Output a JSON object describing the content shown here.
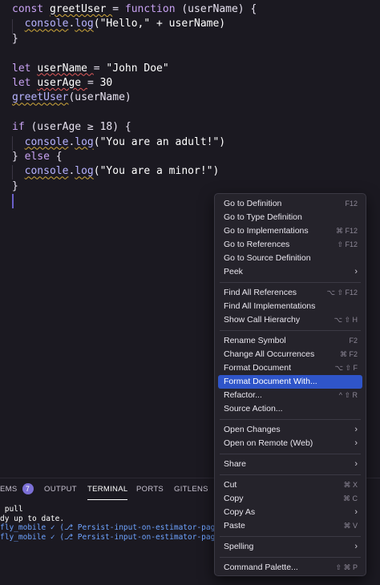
{
  "editor": {
    "lines": [
      {
        "parts": [
          [
            "kw",
            "const "
          ],
          [
            "var",
            "greetUser "
          ],
          [
            "op",
            "= "
          ],
          [
            "kw",
            "function "
          ],
          [
            "op",
            "(userName) {"
          ]
        ]
      },
      {
        "parts": [
          [
            "op",
            "  "
          ],
          [
            "fn",
            "console"
          ],
          [
            "op",
            "."
          ],
          [
            "fn",
            "log"
          ],
          [
            "str",
            "(\"Hello,\" + userName)"
          ]
        ]
      },
      {
        "parts": [
          [
            "op",
            "}"
          ]
        ]
      },
      {
        "parts": []
      },
      {
        "parts": [
          [
            "kw",
            "let "
          ],
          [
            "var",
            "userName "
          ],
          [
            "op",
            "= "
          ],
          [
            "str",
            "\"John Doe\""
          ]
        ]
      },
      {
        "parts": [
          [
            "kw",
            "let "
          ],
          [
            "var",
            "userAge "
          ],
          [
            "op",
            "= "
          ],
          [
            "num",
            "30"
          ]
        ]
      },
      {
        "parts": [
          [
            "fn",
            "greetUser"
          ],
          [
            "op",
            "(userName)"
          ]
        ]
      },
      {
        "parts": []
      },
      {
        "parts": [
          [
            "kw",
            "if "
          ],
          [
            "op",
            "(userAge ≥ 18) {"
          ]
        ]
      },
      {
        "parts": [
          [
            "op",
            "  "
          ],
          [
            "fn",
            "console"
          ],
          [
            "op",
            "."
          ],
          [
            "fn",
            "log"
          ],
          [
            "str",
            "(\"You are an adult!\")"
          ]
        ]
      },
      {
        "parts": [
          [
            "op",
            "} "
          ],
          [
            "kw",
            "else "
          ],
          [
            "op",
            "{"
          ]
        ]
      },
      {
        "parts": [
          [
            "op",
            "  "
          ],
          [
            "fn",
            "console"
          ],
          [
            "op",
            "."
          ],
          [
            "fn",
            "log"
          ],
          [
            "str",
            "(\"You are a minor!\")"
          ]
        ]
      },
      {
        "parts": [
          [
            "op",
            "}"
          ]
        ]
      }
    ]
  },
  "panel": {
    "tabs": {
      "problems": "EMS",
      "problems_count": "7",
      "output": "OUTPUT",
      "terminal": "TERMINAL",
      "ports": "PORTS",
      "gitlens": "GITLENS"
    },
    "terminal_lines": [
      {
        "text": " pull",
        "blue": false
      },
      {
        "text": "dy up to date.",
        "blue": false
      },
      {
        "text": "fly_mobile ✓ (⎇ Persist-input-on-estimator-page)",
        "blue": true
      },
      {
        "text": "fly_mobile ✓ (⎇ Persist-input-on-estimator-page)",
        "blue": true
      }
    ]
  },
  "context_menu": {
    "groups": [
      [
        {
          "label": "Go to Definition",
          "shortcut": "F12"
        },
        {
          "label": "Go to Type Definition",
          "shortcut": ""
        },
        {
          "label": "Go to Implementations",
          "shortcut": "⌘ F12"
        },
        {
          "label": "Go to References",
          "shortcut": "⇧ F12"
        },
        {
          "label": "Go to Source Definition",
          "shortcut": ""
        },
        {
          "label": "Peek",
          "shortcut": "",
          "submenu": true
        }
      ],
      [
        {
          "label": "Find All References",
          "shortcut": "⌥ ⇧ F12"
        },
        {
          "label": "Find All Implementations",
          "shortcut": ""
        },
        {
          "label": "Show Call Hierarchy",
          "shortcut": "⌥ ⇧ H"
        }
      ],
      [
        {
          "label": "Rename Symbol",
          "shortcut": "F2"
        },
        {
          "label": "Change All Occurrences",
          "shortcut": "⌘ F2"
        },
        {
          "label": "Format Document",
          "shortcut": "⌥ ⇧ F"
        },
        {
          "label": "Format Document With...",
          "shortcut": "",
          "highlighted": true
        },
        {
          "label": "Refactor...",
          "shortcut": "^ ⇧ R"
        },
        {
          "label": "Source Action...",
          "shortcut": ""
        }
      ],
      [
        {
          "label": "Open Changes",
          "shortcut": "",
          "submenu": true
        },
        {
          "label": "Open on Remote (Web)",
          "shortcut": "",
          "submenu": true
        }
      ],
      [
        {
          "label": "Share",
          "shortcut": "",
          "submenu": true
        }
      ],
      [
        {
          "label": "Cut",
          "shortcut": "⌘ X"
        },
        {
          "label": "Copy",
          "shortcut": "⌘ C"
        },
        {
          "label": "Copy As",
          "shortcut": "",
          "submenu": true
        },
        {
          "label": "Paste",
          "shortcut": "⌘ V"
        }
      ],
      [
        {
          "label": "Spelling",
          "shortcut": "",
          "submenu": true
        }
      ],
      [
        {
          "label": "Command Palette...",
          "shortcut": "⇧ ⌘ P"
        }
      ]
    ]
  }
}
